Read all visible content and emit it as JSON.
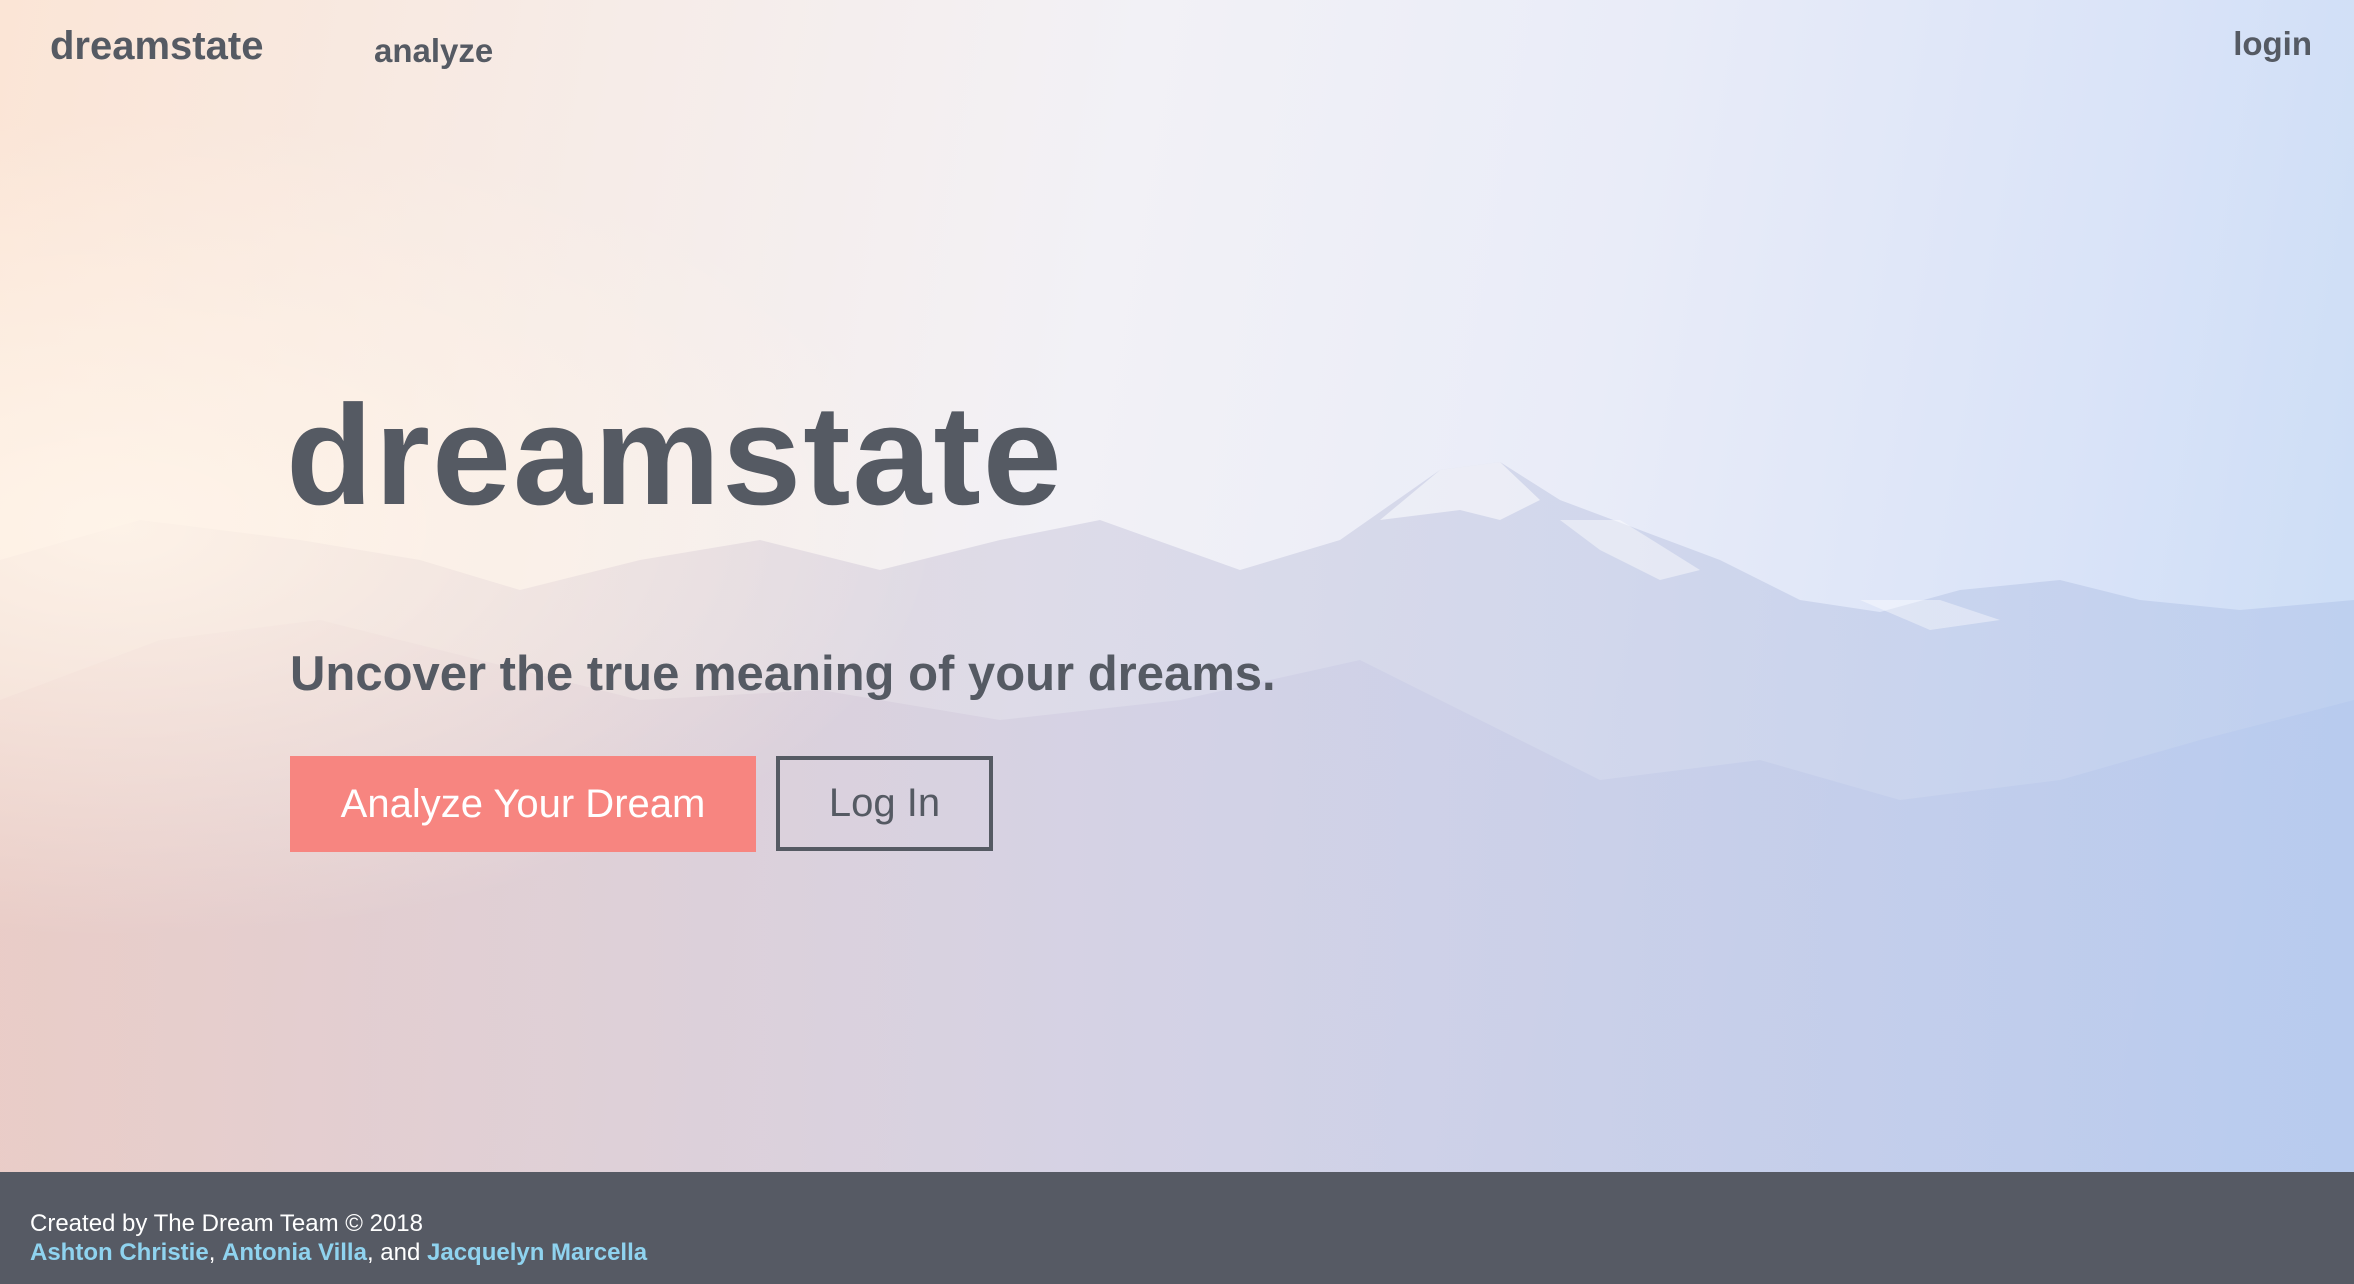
{
  "nav": {
    "brand": "dreamstate",
    "analyze": "analyze",
    "login": "login"
  },
  "hero": {
    "title": "dreamstate",
    "subtitle": "Uncover the true meaning of your dreams.",
    "analyze_button": "Analyze Your Dream",
    "login_button": "Log In",
    "background_image": "snowy mountain range with pastel haze"
  },
  "footer": {
    "credit": "Created by The Dream Team © 2018",
    "authors": [
      "Ashton Christie",
      "Antonia Villa",
      "Jacquelyn Marcella"
    ],
    "sep1": ", ",
    "sep2": ", and "
  },
  "colors": {
    "text": "#555a63",
    "accent": "#f78580",
    "footer_bg": "#565a64",
    "link": "#8fd3ef"
  }
}
